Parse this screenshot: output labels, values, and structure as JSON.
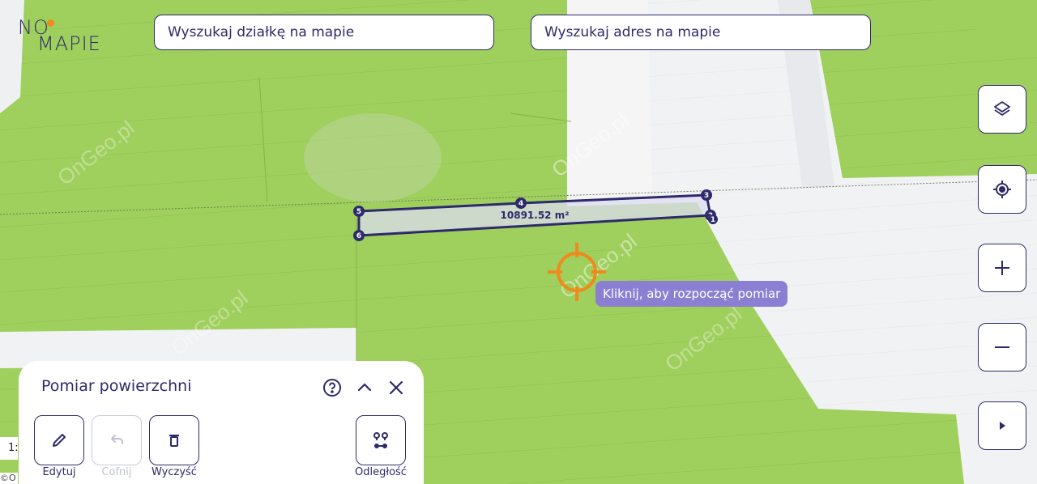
{
  "logo": {
    "line1": "NO",
    "line2": "MAPIE",
    "accent_color": "#ef8a1e",
    "brand_color": "#2e2a6b"
  },
  "search": {
    "parcel_placeholder": "Wyszukaj działkę na mapie",
    "address_placeholder": "Wyszukaj adres na mapie"
  },
  "map": {
    "area_label": "10891.52 m²",
    "vertices": [
      "5",
      "4",
      "3",
      "2",
      "1",
      "6"
    ],
    "watermark": "OnGeo.pl",
    "field_color": "#9fcf5c",
    "measure_color": "#2e2a6b",
    "cursor_color": "#ef8a1e"
  },
  "tooltip": {
    "text": "Kliknij, aby rozpocząć pomiar"
  },
  "side_controls": [
    {
      "name": "layers-icon"
    },
    {
      "name": "locate-icon"
    },
    {
      "name": "zoom-in-icon"
    },
    {
      "name": "zoom-out-icon"
    },
    {
      "name": "expand-icon"
    }
  ],
  "panel": {
    "title": "Pomiar powierzchni",
    "tools": {
      "edit": "Edytuj",
      "undo": "Cofnij",
      "clear": "Wyczyść",
      "distance": "Odległość"
    }
  },
  "scale": {
    "text": "1:"
  },
  "copyright": {
    "text": "©O"
  }
}
